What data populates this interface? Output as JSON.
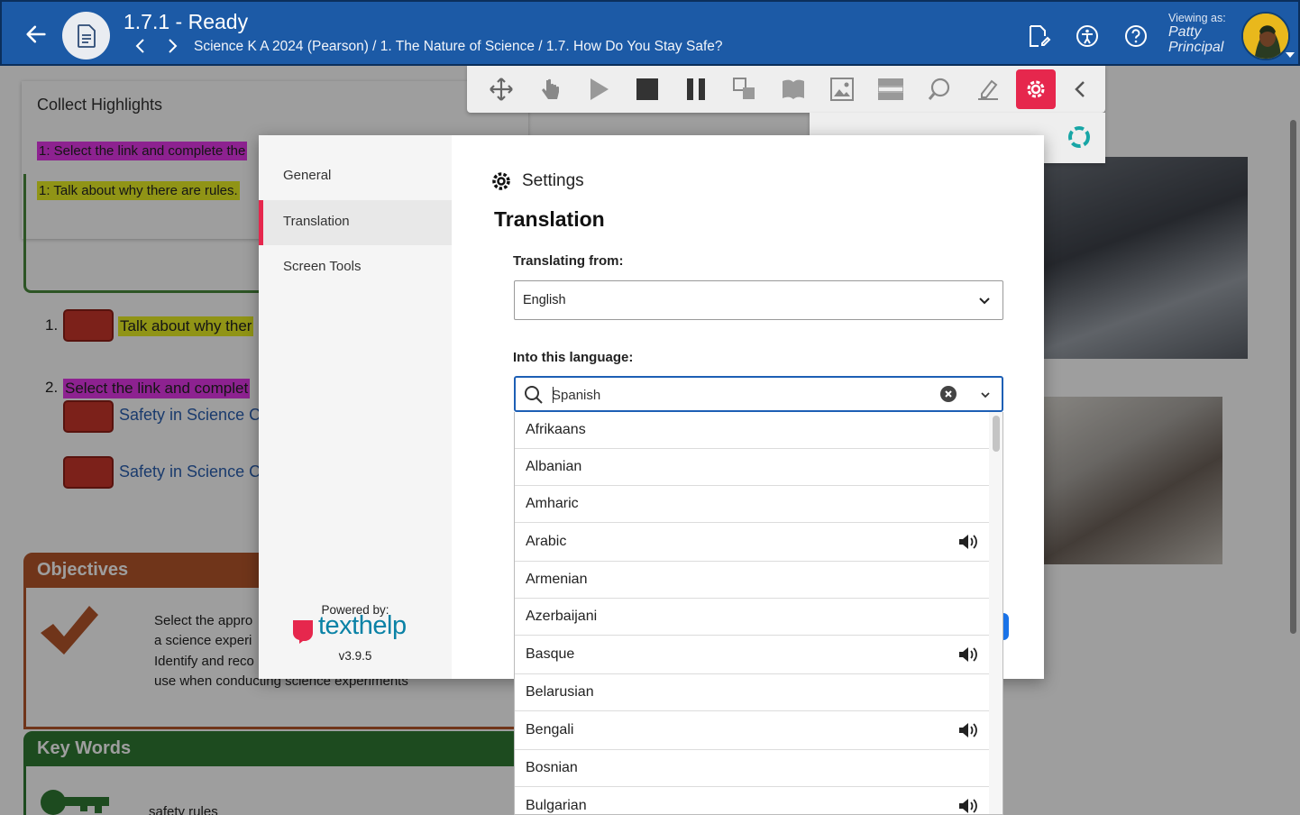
{
  "header": {
    "title": "1.7.1 - Ready",
    "breadcrumb": "Science K A 2024 (Pearson) / 1. The Nature of Science / 1.7. How Do You Stay Safe?",
    "viewing_as_label": "Viewing as:",
    "viewer_first": "Patty",
    "viewer_last": "Principal"
  },
  "background": {
    "highlights_title": "Collect Highlights",
    "highlight_1": "1: Select the link and complete the",
    "highlight_2": "1: Talk about why there are rules.",
    "item_1_num": "1.",
    "item_1_text": "Talk about why ther",
    "item_2_num": "2.",
    "item_2_text": "Select the link and complet",
    "link_1": "Safety in Science C",
    "link_2": "Safety in Science C",
    "objectives_title": "Objectives",
    "objective_1a": "Select the appro",
    "objective_1b": "a science experi",
    "objective_2a": "Identify and reco",
    "objective_2b": "use when conducting science experiments",
    "keywords_title": "Key Words",
    "keyword_1": "safety rules"
  },
  "settings": {
    "nav": [
      {
        "label": "General"
      },
      {
        "label": "Translation"
      },
      {
        "label": "Screen Tools"
      }
    ],
    "powered_by": "Powered by:",
    "brand": "texthelp",
    "version": "v3.9.5",
    "heading": "Settings",
    "section_title": "Translation",
    "from_label": "Translating from:",
    "from_value": "English",
    "into_label": "Into this language:",
    "into_value": "Spanish"
  },
  "languages": [
    {
      "name": "Afrikaans",
      "speech": false
    },
    {
      "name": "Albanian",
      "speech": false
    },
    {
      "name": "Amharic",
      "speech": false
    },
    {
      "name": "Arabic",
      "speech": true
    },
    {
      "name": "Armenian",
      "speech": false
    },
    {
      "name": "Azerbaijani",
      "speech": false
    },
    {
      "name": "Basque",
      "speech": true
    },
    {
      "name": "Belarusian",
      "speech": false
    },
    {
      "name": "Bengali",
      "speech": true
    },
    {
      "name": "Bosnian",
      "speech": false
    },
    {
      "name": "Bulgarian",
      "speech": true
    }
  ],
  "colors": {
    "header_blue": "#1c5aa6",
    "accent_pink": "#e6274d",
    "focus_blue": "#1d5fb5",
    "texthelp_teal": "#0a82a6"
  }
}
